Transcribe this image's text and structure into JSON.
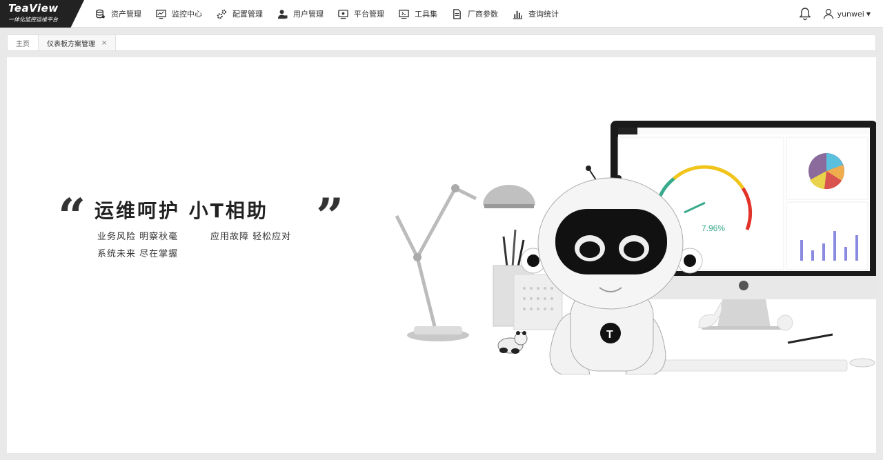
{
  "app": {
    "logo_title": "TeaView",
    "logo_subtitle": "一体化监控运维平台"
  },
  "nav": {
    "items": [
      {
        "label": "资产管理",
        "icon": "database-icon"
      },
      {
        "label": "监控中心",
        "icon": "monitor-icon"
      },
      {
        "label": "配置管理",
        "icon": "gears-icon"
      },
      {
        "label": "用户管理",
        "icon": "user-icon"
      },
      {
        "label": "平台管理",
        "icon": "display-icon"
      },
      {
        "label": "工具集",
        "icon": "toolbox-icon"
      },
      {
        "label": "厂商参数",
        "icon": "document-icon"
      },
      {
        "label": "查询统计",
        "icon": "bar-chart-icon"
      }
    ]
  },
  "user": {
    "name": "yunwei"
  },
  "tabs": [
    {
      "label": "主页",
      "closable": false
    },
    {
      "label": "仪表板方案管理",
      "closable": true,
      "close_glyph": "×"
    }
  ],
  "banner": {
    "open_quote": "“",
    "close_quote": "”",
    "headline": "运维呵护  小T相助",
    "line1_left": "业务风险  明察秋毫",
    "line1_right": "应用故障  轻松应对",
    "line2": "系统未来  尽在掌握",
    "gauge_value": "7.96%",
    "robot_badge": "T"
  },
  "colors": {
    "accent": "#222222",
    "gauge_green": "#3aaa8c",
    "gauge_yellow": "#f0c419",
    "gauge_red": "#e2332a"
  }
}
